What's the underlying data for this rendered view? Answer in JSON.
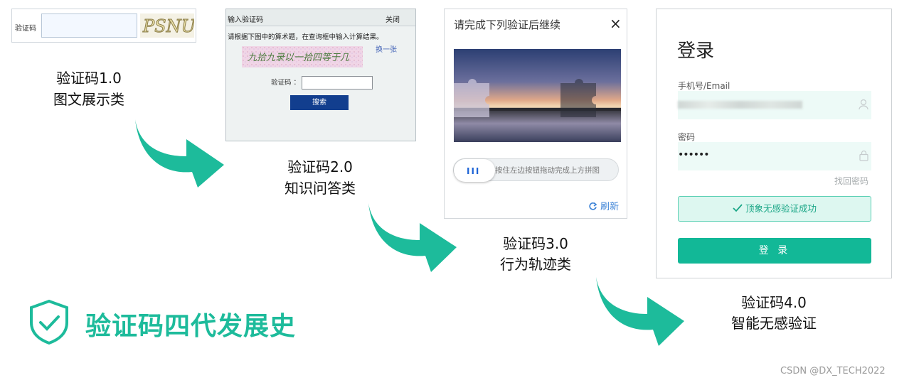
{
  "gen1": {
    "field_label": "验证码",
    "captcha_text": "PSNU",
    "caption_title": "验证码1.0",
    "caption_sub": "图文展示类"
  },
  "gen2": {
    "window_title": "输入验证码",
    "close_label": "关闭",
    "question": "请根据下图中的算术题，在查询框中输入计算结果。",
    "captcha_text": "九拾九录以一拾四等于几",
    "swap_label": "换一张",
    "field_label": "验证码 ：",
    "search_button": "搜索",
    "caption_title": "验证码2.0",
    "caption_sub": "知识问答类"
  },
  "gen3": {
    "title": "请完成下列验证后继续",
    "close_icon": "×",
    "knob_icon": "III",
    "slider_hint": "按住左边按钮拖动完成上方拼图",
    "refresh_label": "刷新",
    "caption_title": "验证码3.0",
    "caption_sub": "行为轨迹类"
  },
  "gen4": {
    "heading": "登录",
    "phone_label": "手机号/Email",
    "password_label": "密码",
    "password_mask": "••••••",
    "forgot_label": "找回密码",
    "verify_success": "顶象无感验证成功",
    "login_button": "登 录",
    "caption_title": "验证码4.0",
    "caption_sub": "智能无感验证"
  },
  "heading": "验证码四代发展史",
  "credit": "CSDN @DX_TECH2022",
  "colors": {
    "accent": "#1dbb9b",
    "login_button": "#12b897",
    "search_button": "#123e8e"
  }
}
